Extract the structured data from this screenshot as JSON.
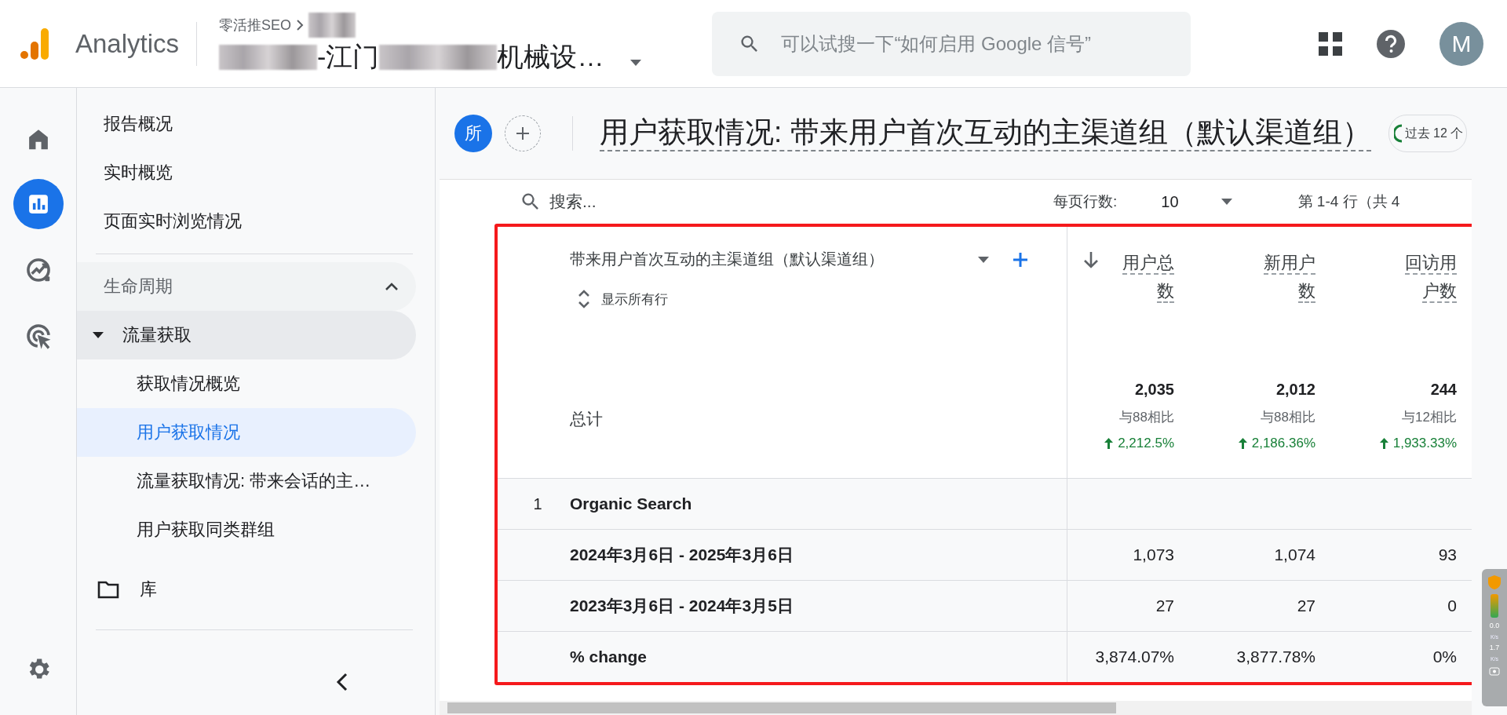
{
  "header": {
    "app_name": "Analytics",
    "breadcrumb": "零活推SEO",
    "property_segments": [
      {
        "kind": "redacted"
      },
      {
        "kind": "text",
        "text": "-江门"
      },
      {
        "kind": "redacted"
      },
      {
        "kind": "text",
        "text": "机械设…"
      }
    ],
    "search": {
      "placeholder": "可以试搜一下“如何启用 Google 信号”"
    },
    "avatar": "M"
  },
  "rail": {
    "items": [
      {
        "kind": "home",
        "selected": false
      },
      {
        "kind": "reports",
        "selected": true
      },
      {
        "kind": "explore",
        "selected": false
      },
      {
        "kind": "advertising",
        "selected": false
      }
    ]
  },
  "nav": {
    "items": [
      {
        "label": "报告概况"
      },
      {
        "label": "实时概览"
      },
      {
        "label": "页面实时浏览情况"
      }
    ],
    "sections": [
      {
        "label": "生命周期",
        "expanded": true,
        "children": [
          {
            "label": "流量获取",
            "expanded": true,
            "children": [
              {
                "label": "获取情况概览",
                "selected": false
              },
              {
                "label": "用户获取情况",
                "selected": true
              },
              {
                "label": "流量获取情况: 带来会话的主…",
                "selected": false
              },
              {
                "label": "用户获取同类群组",
                "selected": false
              }
            ]
          }
        ]
      }
    ],
    "library": "库"
  },
  "report": {
    "comparison_chip": "所",
    "title": "用户获取情况: 带来用户首次互动的主渠道组（默认渠道组）",
    "date_chip": "过去 12 个"
  },
  "table": {
    "search_placeholder": "搜索...",
    "rows_per_page_label": "每页行数:",
    "rows_per_page": "10",
    "range": "第 1-4 行（共 4",
    "dimension_header": "带来用户首次互动的主渠道组（默认渠道组）",
    "show_all_rows": "显示所有行",
    "columns": [
      {
        "label": "用户总数",
        "sorted": true
      },
      {
        "label": "新用户数",
        "sorted": false
      },
      {
        "label": "回访用户数",
        "sorted": false
      }
    ],
    "total": {
      "label": "总计",
      "cells": [
        {
          "value": "2,035",
          "compare": "与88相比",
          "change": "2,212.5%",
          "kind": "up"
        },
        {
          "value": "2,012",
          "compare": "与88相比",
          "change": "2,186.36%",
          "kind": "up"
        },
        {
          "value": "244",
          "compare": "与12相比",
          "change": "1,933.33%",
          "kind": "up"
        }
      ]
    },
    "rows": [
      {
        "index": "1",
        "label": "Organic Search",
        "values": []
      },
      {
        "label": "2024年3月6日 - 2025年3月6日",
        "values": [
          "1,073",
          "1,074",
          "93"
        ]
      },
      {
        "label": "2023年3月6日 - 2024年3月5日",
        "values": [
          "27",
          "27",
          "0"
        ]
      },
      {
        "label": "% change",
        "values": [
          "3,874.07%",
          "3,877.78%",
          "0%"
        ]
      }
    ]
  },
  "network_monitor": {
    "upload": "0.0",
    "upload_unit": "K/s",
    "download": "1.7",
    "download_unit": "K/s"
  }
}
